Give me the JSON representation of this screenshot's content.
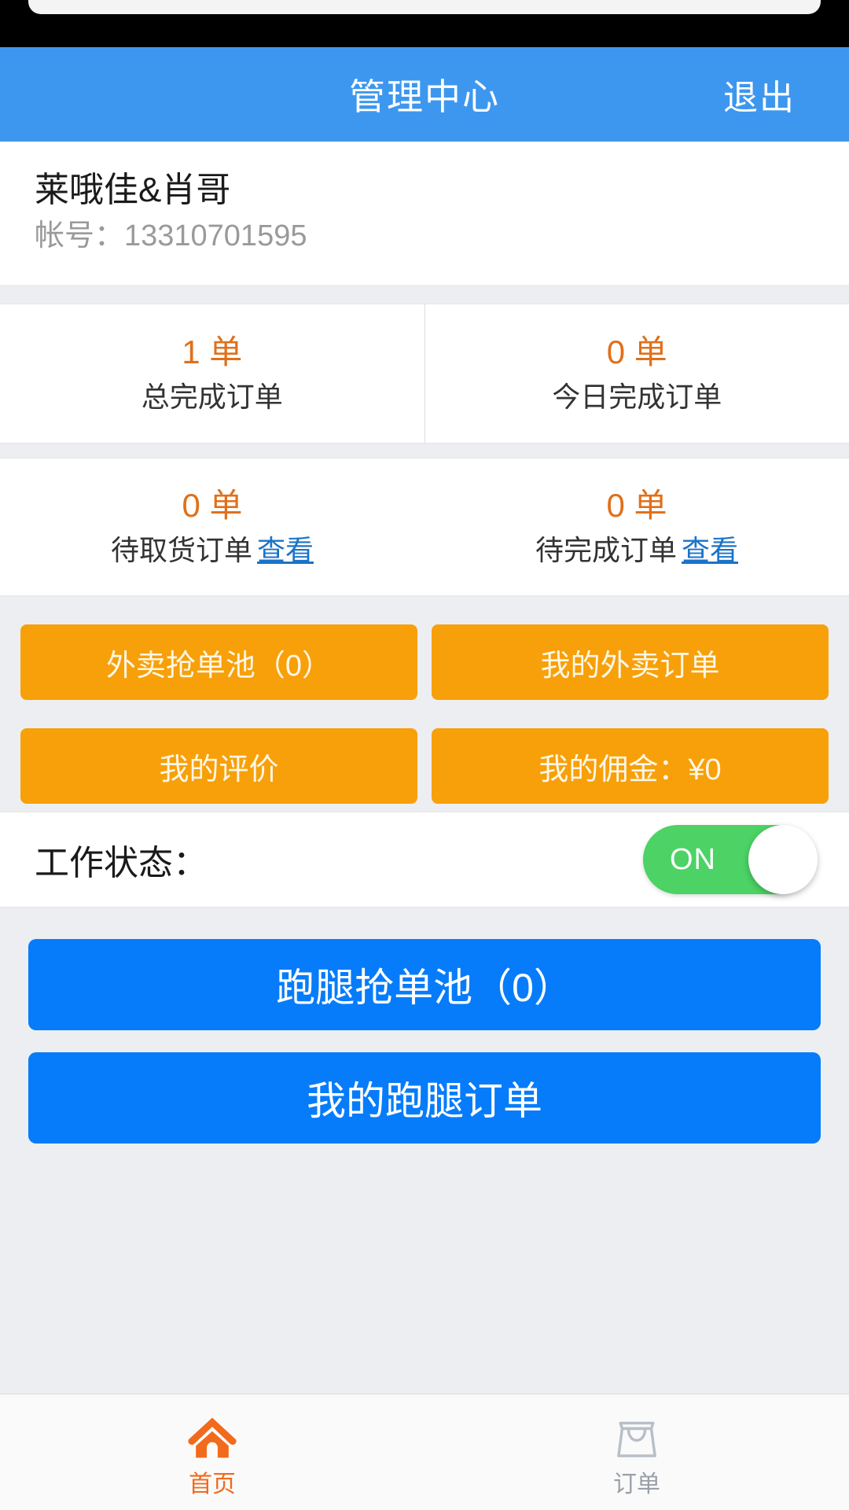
{
  "header": {
    "title": "管理中心",
    "logout_label": "退出"
  },
  "profile": {
    "name": "莱哦佳&肖哥",
    "account_label": "帐号：",
    "account_number": "13310701595",
    "account_line": "帐号：13310701595"
  },
  "stats": {
    "row1": [
      {
        "value": "1 单",
        "label": "总完成订单"
      },
      {
        "value": "0 单",
        "label": "今日完成订单"
      }
    ],
    "row2": [
      {
        "value": "0 单",
        "label": "待取货订单",
        "link": "查看"
      },
      {
        "value": "0 单",
        "label": "待完成订单",
        "link": "查看"
      }
    ]
  },
  "actions_orange": [
    {
      "label": "外卖抢单池（0）"
    },
    {
      "label": "我的外卖订单"
    },
    {
      "label": "我的评价"
    },
    {
      "label": "我的佣金：¥0"
    }
  ],
  "work_status": {
    "label": "工作状态：",
    "toggle_state": "ON"
  },
  "actions_blue": [
    {
      "label": "跑腿抢单池（0）"
    },
    {
      "label": "我的跑腿订单"
    }
  ],
  "tabbar": [
    {
      "label": "首页",
      "icon": "home-icon",
      "active": true
    },
    {
      "label": "订单",
      "icon": "bag-icon",
      "active": false
    }
  ],
  "colors": {
    "header_blue": "#3d97ee",
    "accent_orange": "#e0701b",
    "button_orange": "#f7a009",
    "button_blue": "#067cfa",
    "toggle_green": "#4cd265",
    "link_blue": "#1a73c8",
    "tab_active": "#f26a1b",
    "tab_inactive": "#9aa0a8",
    "page_bg": "#eceef1"
  }
}
